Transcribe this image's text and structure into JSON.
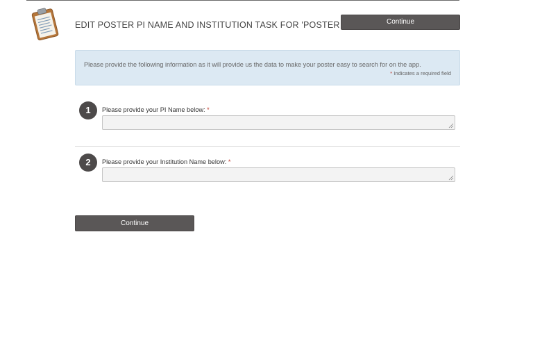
{
  "header": {
    "title": "EDIT POSTER PI NAME AND INSTITUTION TASK FOR 'POSTER ...",
    "continue_label": "Continue",
    "icon": "clipboard-icon"
  },
  "info": {
    "text": "Please provide the following information as it will provide us the data to make your poster easy to search for on the app.",
    "required_marker": "*",
    "required_note": "Indicates a required field"
  },
  "questions": [
    {
      "number": "1",
      "label": "Please provide your PI Name below:",
      "required": "*",
      "value": ""
    },
    {
      "number": "2",
      "label": "Please provide your Institution Name below:",
      "required": "*",
      "value": ""
    }
  ],
  "footer": {
    "continue_label": "Continue"
  },
  "colors": {
    "button": "#5a5757",
    "info_bg": "#dce9f3",
    "required": "#c0392b",
    "badge": "#4d4a4a"
  }
}
